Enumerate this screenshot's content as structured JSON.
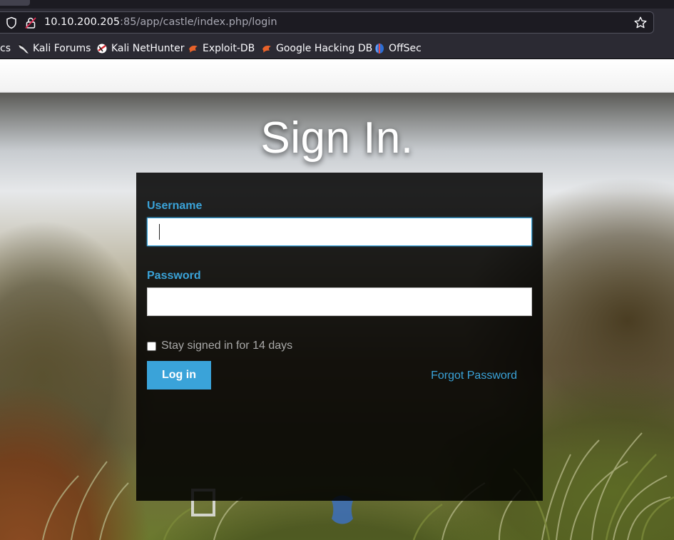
{
  "browser": {
    "url_host": "10.10.200.205",
    "url_rest": ":85/app/castle/index.php/login",
    "bookmarks": [
      {
        "label": "cs",
        "icon": "none"
      },
      {
        "label": "Kali Forums",
        "icon": "kali-dragon-icon"
      },
      {
        "label": "Kali NetHunter",
        "icon": "nethunter-icon"
      },
      {
        "label": "Exploit-DB",
        "icon": "exploit-db-icon"
      },
      {
        "label": "Google Hacking DB",
        "icon": "ghdb-icon"
      },
      {
        "label": "OffSec",
        "icon": "offsec-icon"
      }
    ]
  },
  "login": {
    "title": "Sign In.",
    "username_label": "Username",
    "username_value": "",
    "password_label": "Password",
    "password_value": "",
    "remember_label": "Stay signed in for 14 days",
    "remember_checked": false,
    "login_button": "Log in",
    "forgot_link": "Forgot Password"
  },
  "colors": {
    "accent": "#3aa3d9",
    "panel": "#000000",
    "chrome": "#2b2a33"
  }
}
